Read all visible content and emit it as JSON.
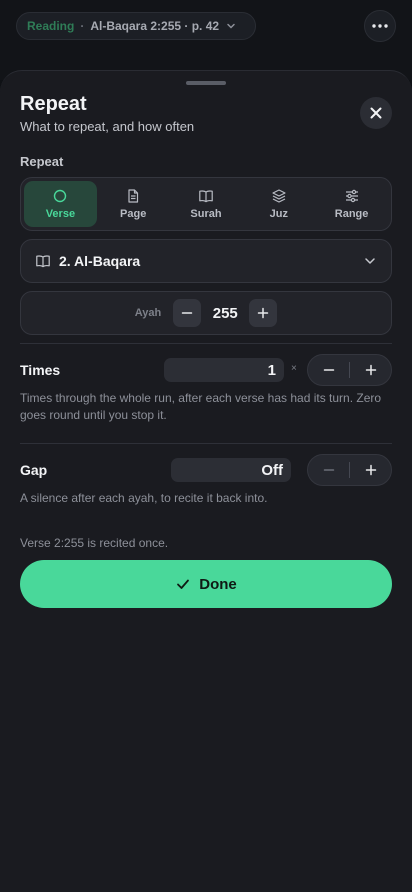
{
  "topbar": {
    "status": "Reading",
    "separator": "·",
    "location": "Al-Baqara 2:255 · p. 42"
  },
  "sheet": {
    "title": "Repeat",
    "subtitle": "What to repeat, and how often",
    "section_label": "Repeat",
    "modes": [
      {
        "label": "Verse",
        "icon": "circle-icon",
        "active": true
      },
      {
        "label": "Page",
        "icon": "page-icon",
        "active": false
      },
      {
        "label": "Surah",
        "icon": "book-icon",
        "active": false
      },
      {
        "label": "Juz",
        "icon": "layers-icon",
        "active": false
      },
      {
        "label": "Range",
        "icon": "sliders-icon",
        "active": false
      }
    ],
    "surah": "2. Al-Baqara",
    "ayah": {
      "label": "Ayah",
      "value": "255"
    },
    "times": {
      "label": "Times",
      "value": "1",
      "suffix": "×",
      "help": "Times through the whole run, after each verse has had its turn. Zero goes round until you stop it."
    },
    "gap": {
      "label": "Gap",
      "value": "Off",
      "help": "A silence after each ayah, to recite it back into."
    },
    "summary": "Verse 2:255 is recited once.",
    "done_label": "Done"
  },
  "colors": {
    "accent": "#49d89a",
    "sheet_bg": "#1a1b20",
    "active_segment_bg": "#27473b"
  }
}
